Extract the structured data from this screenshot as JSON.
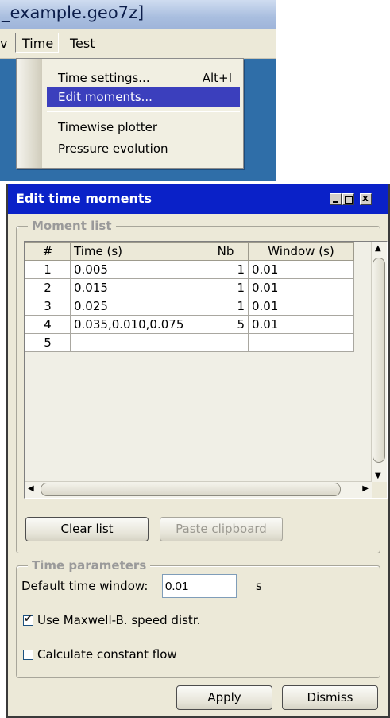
{
  "window_title": "_example.geo7z]",
  "menubar": {
    "prev_fragment": "v",
    "time": "Time",
    "test": "Test"
  },
  "time_menu": {
    "items": [
      {
        "label": "Time settings...",
        "shortcut": "Alt+I"
      },
      {
        "label": "Edit moments..."
      },
      {
        "label": "Timewise plotter"
      },
      {
        "label": "Pressure evolution"
      }
    ]
  },
  "dialog": {
    "title": "Edit time moments",
    "moment_list": {
      "legend": "Moment list",
      "columns": [
        "#",
        "Time (s)",
        "Nb",
        "Window (s)"
      ],
      "rows": [
        {
          "num": "1",
          "time": "0.005",
          "nb": "1",
          "window": "0.01"
        },
        {
          "num": "2",
          "time": "0.015",
          "nb": "1",
          "window": "0.01"
        },
        {
          "num": "3",
          "time": "0.025",
          "nb": "1",
          "window": "0.01"
        },
        {
          "num": "4",
          "time": "0.035,0.010,0.075",
          "nb": "5",
          "window": "0.01"
        },
        {
          "num": "5",
          "time": "",
          "nb": "",
          "window": ""
        }
      ],
      "clear_button": "Clear list",
      "paste_button": "Paste clipboard"
    },
    "time_parameters": {
      "legend": "Time parameters",
      "default_window_label": "Default time window:",
      "default_window_value": "0.01",
      "default_window_unit": "s",
      "maxwell_label": "Use Maxwell-B. speed distr.",
      "maxwell_checked": true,
      "constant_flow_label": "Calculate constant flow",
      "constant_flow_checked": false
    },
    "apply_button": "Apply",
    "dismiss_button": "Dismiss"
  },
  "colors": {
    "titlebar": "#0a21c8",
    "menu_highlight": "#3b3fbd",
    "dialog_bg": "#ece9d8",
    "desktop": "#2f6ea8"
  }
}
